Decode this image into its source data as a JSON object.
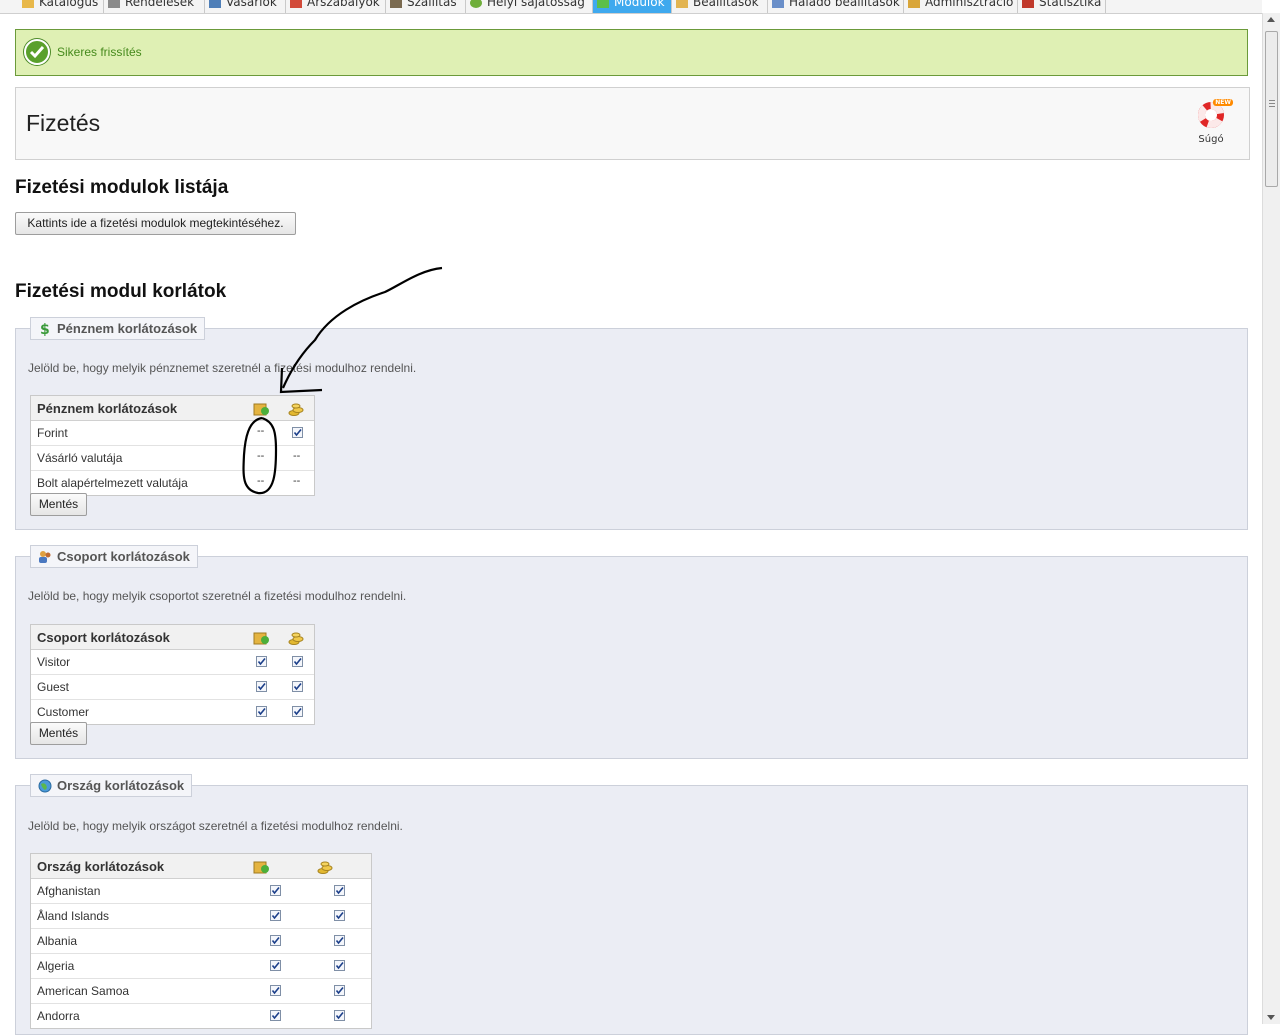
{
  "nav": {
    "tabs": [
      "Katalógus",
      "Rendelések",
      "Vásárlók",
      "Árszabályok",
      "Szállítás",
      "Helyi sajátosság",
      "Modulok",
      "Beállítások",
      "Haladó beállítások",
      "Adminisztráció",
      "Statisztika"
    ],
    "active_tab": "Modulok"
  },
  "success": {
    "message": "Sikeres frissítés"
  },
  "header": {
    "title": "Fizetés",
    "help_label": "Súgó",
    "help_badge": "NEW"
  },
  "modules_list": {
    "heading": "Fizetési modulok listája",
    "button_label": "Kattints ide a fizetési modulok megtekintéséhez."
  },
  "restrictions_heading": "Fizetési modul korlátok",
  "currency": {
    "legend": "Pénznem korlátozások",
    "description": "Jelöld be, hogy melyik pénznemet szeretnél a fizetési modulhoz rendelni.",
    "table_title": "Pénznem korlátozások",
    "rows": [
      {
        "name": "Forint",
        "col1": "--",
        "col2": "checked"
      },
      {
        "name": "Vásárló valutája",
        "col1": "--",
        "col2": "--"
      },
      {
        "name": "Bolt alapértelmezett valutája",
        "col1": "--",
        "col2": "--"
      }
    ],
    "save_label": "Mentés"
  },
  "group": {
    "legend": "Csoport korlátozások",
    "description": "Jelöld be, hogy melyik csoportot szeretnél a fizetési modulhoz rendelni.",
    "table_title": "Csoport korlátozások",
    "rows": [
      {
        "name": "Visitor",
        "col1": "checked",
        "col2": "checked"
      },
      {
        "name": "Guest",
        "col1": "checked",
        "col2": "checked"
      },
      {
        "name": "Customer",
        "col1": "checked",
        "col2": "checked"
      }
    ],
    "save_label": "Mentés"
  },
  "country": {
    "legend": "Ország korlátozások",
    "description": "Jelöld be, hogy melyik országot szeretnél a fizetési modulhoz rendelni.",
    "table_title": "Ország korlátozások",
    "rows": [
      {
        "name": "Afghanistan",
        "col1": "checked",
        "col2": "checked"
      },
      {
        "name": "Åland Islands",
        "col1": "checked",
        "col2": "checked"
      },
      {
        "name": "Albania",
        "col1": "checked",
        "col2": "checked"
      },
      {
        "name": "Algeria",
        "col1": "checked",
        "col2": "checked"
      },
      {
        "name": "American Samoa",
        "col1": "checked",
        "col2": "checked"
      },
      {
        "name": "Andorra",
        "col1": "checked",
        "col2": "checked"
      }
    ]
  },
  "colors": {
    "accent": "#3fa9ee",
    "success_bg": "#dff0b4",
    "success_text": "#468a1c",
    "panel_bg": "#ebedf4"
  },
  "icons": {
    "col1_header": "module-package-icon",
    "col2_header": "coins-icon",
    "currency_legend": "dollar-icon",
    "group_legend": "group-icon",
    "country_legend": "globe-icon"
  }
}
